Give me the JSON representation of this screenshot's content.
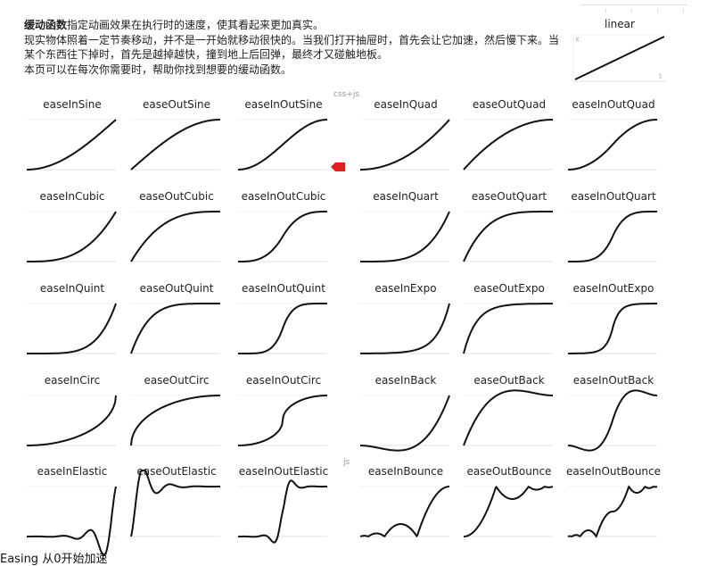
{
  "intro": {
    "title": "缓动函数",
    "title_rest": "指定动画效果在执行时的速度，使其看起来更加真实。",
    "line2": "现实物体照着一定节奏移动，并不是一开始就移动很快的。当我们打开抽屉时，首先会让它加速，然后慢下来。当某个东西往下掉时，首先是越掉越快，撞到地上后回弹，最终才又碰触地板。",
    "line3": "本页可以在每次你需要时，帮助你找到想要的缓动函数。"
  },
  "labels": {
    "css_js": "css+js",
    "js": "js"
  },
  "linear": {
    "name": "linear",
    "x_axis": "t",
    "y_axis": "x"
  },
  "grid": [
    [
      "easeInSine",
      "easeOutSine",
      "easeInOutSine",
      "easeInQuad",
      "easeOutQuad",
      "easeInOutQuad"
    ],
    [
      "easeInCubic",
      "easeOutCubic",
      "easeInOutCubic",
      "easeInQuart",
      "easeOutQuart",
      "easeInOutQuart"
    ],
    [
      "easeInQuint",
      "easeOutQuint",
      "easeInOutQuint",
      "easeInExpo",
      "easeOutExpo",
      "easeInOutExpo"
    ],
    [
      "easeInCirc",
      "easeOutCirc",
      "easeInOutCirc",
      "easeInBack",
      "easeOutBack",
      "easeInOutBack"
    ],
    [
      "easeInElastic",
      "easeOutElastic",
      "easeInOutElastic",
      "easeInBounce",
      "easeOutBounce",
      "easeInOutBounce"
    ]
  ],
  "bottom_text": "Easing 从0开始加速"
}
